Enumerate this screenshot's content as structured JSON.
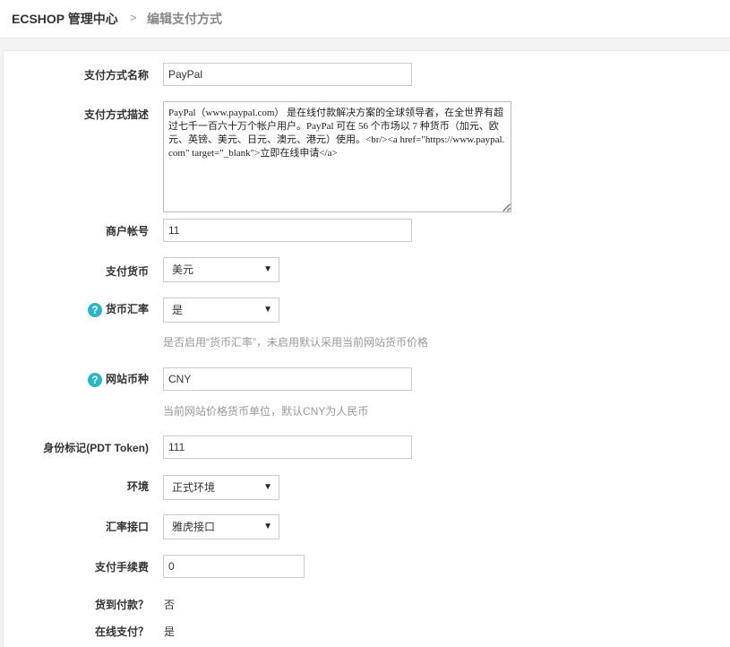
{
  "header": {
    "brand": "ECSHOP 管理中心",
    "separator": ">",
    "crumb": "编辑支付方式"
  },
  "form": {
    "pay_name": {
      "label": "支付方式名称",
      "value": "PayPal"
    },
    "pay_desc": {
      "label": "支付方式描述",
      "value": "PayPal（www.paypal.com） 是在线付款解决方案的全球领导者，在全世界有超过七千一百六十万个帐户用户。PayPal 可在 56 个市场以 7 种货币（加元、欧元、英镑、美元、日元、澳元、港元）使用。<br/><a href=\"https://www.paypal.com\" target=\"_blank\">立即在线申请</a>"
    },
    "merchant_account": {
      "label": "商户帐号",
      "value": "11"
    },
    "pay_currency": {
      "label": "支付货币",
      "value": "美元"
    },
    "exchange_rate": {
      "label": "货币汇率",
      "value": "是",
      "hint": "是否启用“货币汇率”，未启用默认采用当前网站货币价格"
    },
    "site_currency": {
      "label": "网站币种",
      "value": "CNY",
      "hint": "当前网站价格货币单位，默认CNY为人民币"
    },
    "pdt_token": {
      "label": "身份标记(PDT Token)",
      "value": "111"
    },
    "environment": {
      "label": "环境",
      "value": "正式环境"
    },
    "rate_api": {
      "label": "汇率接口",
      "value": "雅虎接口"
    },
    "pay_fee": {
      "label": "支付手续费",
      "value": "0"
    },
    "cod": {
      "label": "货到付款？",
      "value": "否"
    },
    "online_pay": {
      "label": "在线支付？",
      "value": "是"
    }
  },
  "icons": {
    "help": "question-circle-icon",
    "dropdown": "chevron-down-icon",
    "help_glyph": "?",
    "arrow_glyph": "▼"
  }
}
